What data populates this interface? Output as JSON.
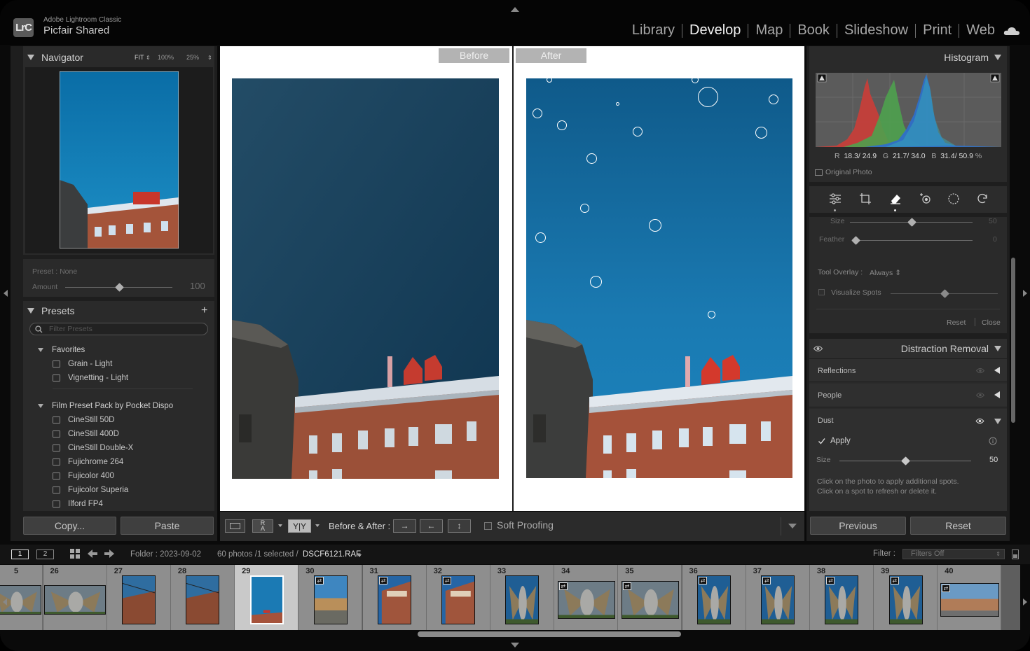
{
  "app": {
    "product": "Adobe Lightroom Classic",
    "catalog": "Picfair Shared",
    "logo": "LrC"
  },
  "modules": [
    {
      "label": "Library",
      "active": false
    },
    {
      "label": "Develop",
      "active": true
    },
    {
      "label": "Map",
      "active": false
    },
    {
      "label": "Book",
      "active": false
    },
    {
      "label": "Slideshow",
      "active": false
    },
    {
      "label": "Print",
      "active": false
    },
    {
      "label": "Web",
      "active": false
    }
  ],
  "navigator": {
    "title": "Navigator",
    "zoom_fit": "FIT",
    "zoom_100": "100%",
    "zoom_25": "25%"
  },
  "preset_bar": {
    "preset_label": "Preset : None",
    "amount_label": "Amount",
    "amount_value": "100",
    "amount_fraction": 0.5
  },
  "presets": {
    "title": "Presets",
    "add": "+",
    "filter_placeholder": "Filter Presets",
    "groups": [
      {
        "name": "Favorites",
        "items": [
          "Grain - Light",
          "Vignetting - Light"
        ]
      },
      {
        "name": "Film Preset Pack by Pocket Dispo",
        "items": [
          "CineStill 50D",
          "CineStill 400D",
          "CineStill Double-X",
          "Fujichrome 264",
          "Fujicolor 400",
          "Fujicolor Superia",
          "Ilford FP4"
        ]
      }
    ]
  },
  "left_buttons": {
    "copy": "Copy...",
    "paste": "Paste"
  },
  "compare": {
    "before": "Before",
    "after": "After"
  },
  "toolbar": {
    "before_after_label": "Before & After :",
    "soft_proofing": "Soft Proofing",
    "view_yy": "Y|Y"
  },
  "histogram": {
    "title": "Histogram",
    "r_label": "R",
    "r_value": "18.3/ 24.9",
    "g_label": "G",
    "g_value": "21.7/ 34.0",
    "b_label": "B",
    "b_value": "31.4/ 50.9",
    "unit": "%",
    "original_photo": "Original Photo"
  },
  "tools": [
    "sliders-icon",
    "crop-icon",
    "eraser-icon",
    "red-eye-icon",
    "masking-icon",
    "reset-icon"
  ],
  "heal_panel": {
    "size_label": "Size",
    "size_value": "50",
    "feather_label": "Feather",
    "feather_value": "0",
    "tool_overlay_label": "Tool Overlay :",
    "tool_overlay_value": "Always",
    "visualize_spots": "Visualize Spots",
    "reset": "Reset",
    "close": "Close"
  },
  "distraction": {
    "title": "Distraction Removal",
    "sections": [
      "Reflections",
      "People",
      "Dust"
    ],
    "apply": "Apply",
    "size_label": "Size",
    "size_value": "50",
    "size_fraction": 0.5,
    "hint1": "Click on the photo to apply additional spots.",
    "hint2": "Click on a spot to refresh or delete it."
  },
  "right_buttons": {
    "previous": "Previous",
    "reset": "Reset"
  },
  "filmstrip_bar": {
    "screen1": "1",
    "screen2": "2",
    "folder": "Folder : 2023-09-02",
    "count": "60 photos /1 selected /",
    "filename": "DSCF6121.RAF",
    "filter_label": "Filter :",
    "filter_value": "Filters Off"
  },
  "filmstrip": {
    "cells": [
      "5",
      "26",
      "27",
      "28",
      "29",
      "30",
      "31",
      "32",
      "33",
      "34",
      "35",
      "36",
      "37",
      "38",
      "39",
      "40"
    ],
    "selected_index": 4
  },
  "colors": {
    "sky": "#1a6fa6",
    "brick": "#a5523a",
    "panel": "#262626",
    "accent_red": "#c8362b"
  }
}
